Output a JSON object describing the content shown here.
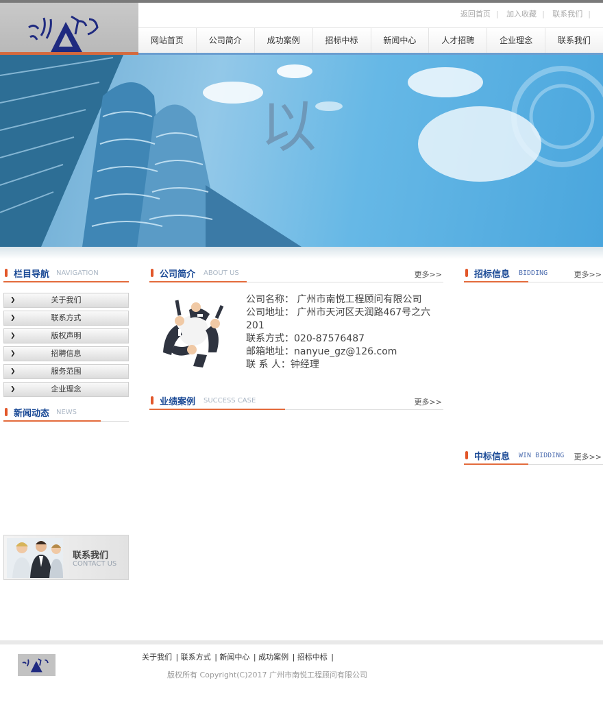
{
  "header": {
    "top_links": [
      "返回首页",
      "加入收藏",
      "联系我们"
    ],
    "nav": [
      "网站首页",
      "公司简介",
      "成功案例",
      "招标中标",
      "新闻中心",
      "人才招聘",
      "企业理念",
      "联系我们"
    ]
  },
  "banner": {
    "glyph": "以"
  },
  "left": {
    "navigation": {
      "title": "栏目导航",
      "sub": "NAVIGATION"
    },
    "items": [
      "关于我们",
      "联系方式",
      "版权声明",
      "招聘信息",
      "服务范围",
      "企业理念"
    ],
    "news": {
      "title": "新闻动态",
      "sub": "NEWS"
    },
    "contact": {
      "title": "联系我们",
      "sub": "CONTACT US"
    }
  },
  "middle": {
    "about": {
      "title": "公司简介",
      "sub": "ABOUT US",
      "more": "更多>>"
    },
    "info": {
      "name": "公司名称： 广州市南悦工程顾问有限公司",
      "address": "公司地址： 广州市天河区天润路467号之六201",
      "phone": "联系方式：020-87576487",
      "email": "邮箱地址：nanyue_gz@126.com",
      "contact": "联 系 人：钟经理"
    },
    "cases": {
      "title": "业绩案例",
      "sub": "SUCCESS CASE",
      "more": "更多>>"
    }
  },
  "right": {
    "bidding": {
      "title": "招标信息",
      "sub": "BIDDING",
      "more": "更多>>"
    },
    "win": {
      "title": "中标信息",
      "sub": "WIN BIDDING",
      "more": "更多>>"
    }
  },
  "footer": {
    "links": [
      "关于我们",
      "联系方式",
      "新闻中心",
      "成功案例",
      "招标中标"
    ],
    "copyright": "版权所有 Copyright(C)2017 广州市南悦工程顾问有限公司"
  },
  "colors": {
    "accent": "#e36b3c",
    "title_blue": "#1b4a96",
    "nav_bar": "#6b9ed0"
  }
}
